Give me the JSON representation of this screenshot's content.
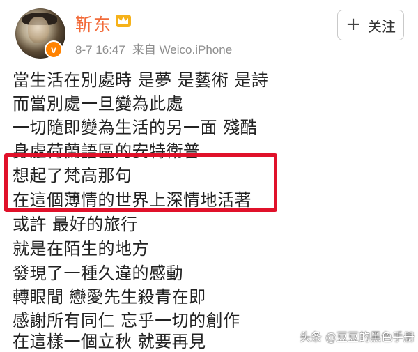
{
  "post": {
    "username": "靳东",
    "date": "8-7 16:47",
    "source": "来自 Weico.iPhone",
    "follow_label": "关注",
    "follow_plus": "+",
    "lines": [
      "當生活在別處時 是夢 是藝術 是詩",
      "而當別處一旦變為此處",
      "一切隨即變為生活的另一面 殘酷",
      "身處荷蘭語區的安特衛普",
      "想起了梵高那句",
      "在這個薄情的世界上深情地活著",
      "或許 最好的旅行",
      "就是在陌生的地方",
      "發現了一種久違的感動",
      "轉眼間 戀愛先生殺青在即",
      "感謝所有同仁 忘乎一切的創作",
      "在這樣一個立秋 就要再見"
    ]
  },
  "icons": {
    "verified": "verified-badge-icon",
    "crown": "crown-member-icon"
  },
  "colors": {
    "username": "#f26b3a",
    "highlight": "#e0112a",
    "verified": "#ff8200"
  },
  "watermark": "头条 @豆豆的黑色手册"
}
